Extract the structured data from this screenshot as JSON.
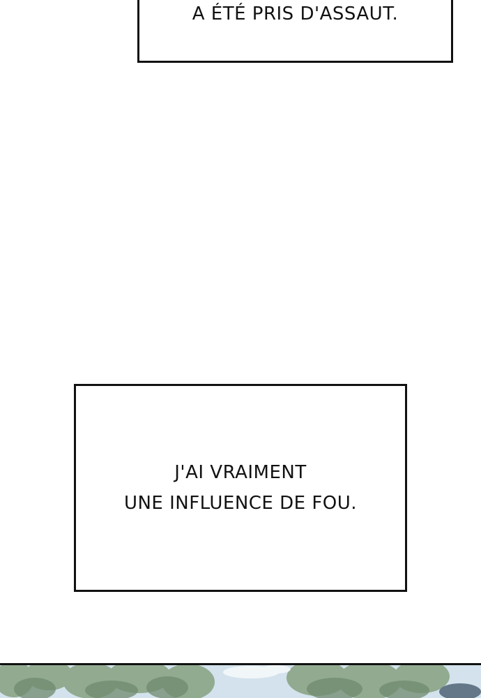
{
  "captions": {
    "top": {
      "line1": "A ÉTÉ PRIS D'ASSAUT."
    },
    "middle": {
      "line1": "J'AI VRAIMENT",
      "line2": "UNE INFLUENCE DE FOU."
    }
  },
  "colors": {
    "ink": "#111111",
    "page": "#ffffff",
    "sky": "#c9dbe8",
    "foliage": "#7f9a7c"
  }
}
